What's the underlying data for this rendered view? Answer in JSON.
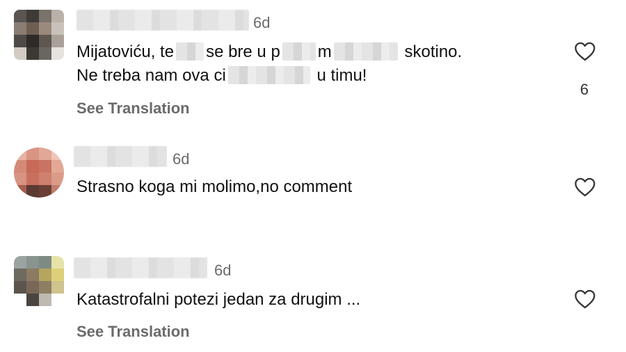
{
  "comments": [
    {
      "time": "6d",
      "line1": {
        "a": "Mijatoviću, te",
        "b": "se bre u p",
        "c": "m",
        "d": "skotino."
      },
      "line2": {
        "a": "Ne treba nam ova ci",
        "b": "u timu!"
      },
      "see_translation": "See Translation",
      "likes": "6"
    },
    {
      "time": "6d",
      "text": "Strasno koga mi molimo,no comment"
    },
    {
      "time": "6d",
      "text": "Katastrofalni potezi jedan za drugim ...",
      "see_translation": "See Translation"
    }
  ],
  "icons": {
    "like": "heart-outline-icon"
  },
  "colors": {
    "meta_text": "#6b6b6b",
    "body_text": "#111111"
  }
}
